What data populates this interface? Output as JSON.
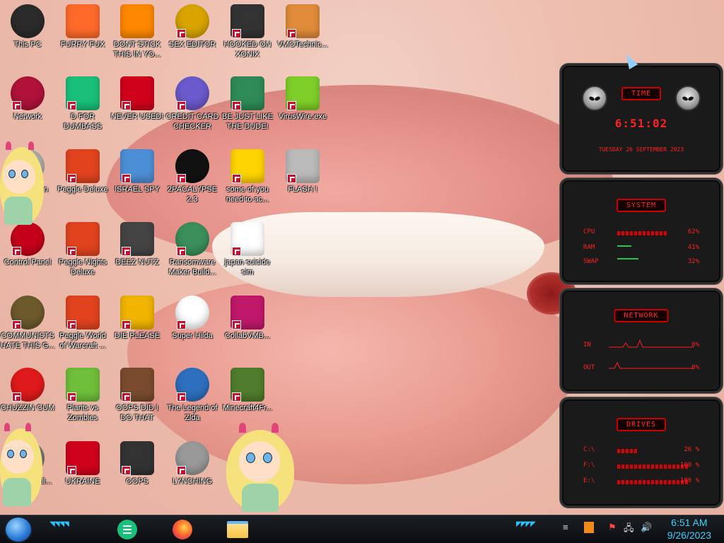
{
  "desktop": {
    "icons": [
      {
        "label": "This PC",
        "icon": "computer-icon",
        "color": "#2b2b2b"
      },
      {
        "label": "FURRY FUX",
        "icon": "firefox-icon",
        "color": "#ff6a2b"
      },
      {
        "label": "DONT STICK THIS IN YO...",
        "icon": "vlc-cone-icon",
        "color": "#ff8800"
      },
      {
        "label": "SEX EDITOR",
        "icon": "hxd-editor-icon",
        "color": "#d9a400"
      },
      {
        "label": "HOOKED ON XONIX",
        "icon": "xonix-game-icon",
        "color": "#333333"
      },
      {
        "label": "VMOTechnic...",
        "icon": "doctor-avatar-icon",
        "color": "#e08c3a"
      },
      {
        "label": "Network",
        "icon": "network-globe-icon",
        "color": "#b0123a"
      },
      {
        "label": "D FOR DUMBASS",
        "icon": "google-docs-icon",
        "color": "#18c07a"
      },
      {
        "label": "NEVER USED!",
        "icon": "dev-cpp-icon",
        "color": "#d0021b"
      },
      {
        "label": "CREDIT CARD CHECKER",
        "icon": "credit-card-icon",
        "color": "#6a5acd"
      },
      {
        "label": "BE JUST LIKE THE DUDE!",
        "icon": "elf-game-icon",
        "color": "#2e8b57"
      },
      {
        "label": "VirusWire.exe",
        "icon": "lime-disc-icon",
        "color": "#7fcf2a"
      },
      {
        "label": "Recycle Bin",
        "icon": "recycle-bin-icon",
        "color": "#aaaaaa"
      },
      {
        "label": "Peggle Deluxe",
        "icon": "peggle-icon",
        "color": "#e2431f"
      },
      {
        "label": "ISRAEL SPY",
        "icon": "network-computer-icon",
        "color": "#4d8fd6"
      },
      {
        "label": "2PACALYPSE 2.3",
        "icon": "terminal-icon",
        "color": "#111111"
      },
      {
        "label": "some of you need to ac...",
        "icon": "dog-cartoon-icon",
        "color": "#ffd400"
      },
      {
        "label": "FLASH !",
        "icon": "flash-cards-icon",
        "color": "#bbbbbb"
      },
      {
        "label": "Control Panel",
        "icon": "control-panel-icon",
        "color": "#c4001a"
      },
      {
        "label": "Peggle Nights Deluxe",
        "icon": "peggle-nights-icon",
        "color": "#e2431f"
      },
      {
        "label": "DEEZ NUTZ",
        "icon": "window-stack-icon",
        "color": "#444444"
      },
      {
        "label": "Ransomware Maker Build...",
        "icon": "app-window-icon",
        "color": "#3a8f5a"
      },
      {
        "label": "japan suicide sim",
        "icon": "game-tile-icon",
        "color": "#ffffff"
      },
      {
        "label": "",
        "icon": "none",
        "color": ""
      },
      {
        "label": "COMMUNISTS HATE THIS G...",
        "icon": "money-bag-icon",
        "color": "#6b5a2b"
      },
      {
        "label": "Peggle World of Warcraft ...",
        "icon": "peggle-warcraft-icon",
        "color": "#e2431f"
      },
      {
        "label": "DIE PLEASE",
        "icon": "de-letters-icon",
        "color": "#f0b400"
      },
      {
        "label": "Super Hilda",
        "icon": "pixel-dog-icon",
        "color": "#ffffff"
      },
      {
        "label": "CollabVMB...",
        "icon": "monitor-icon",
        "color": "#c0186b"
      },
      {
        "label": "",
        "icon": "none",
        "color": ""
      },
      {
        "label": "CHUZZIN CUM",
        "icon": "chuzzle-icon",
        "color": "#e01a1a"
      },
      {
        "label": "Plants vs Zombies",
        "icon": "plant-icon",
        "color": "#6fbf3a"
      },
      {
        "label": "OOPS DID I DO THAT",
        "icon": "portrait-icon",
        "color": "#7a4b2e"
      },
      {
        "label": "The Legend of Zlda",
        "icon": "pixel-hero-icon",
        "color": "#2f6fbf"
      },
      {
        "label": "Minecraft4Fr...",
        "icon": "grass-block-icon",
        "color": "#4f7d2b"
      },
      {
        "label": "",
        "icon": "none",
        "color": ""
      },
      {
        "label": "...oad ...k All...",
        "icon": "download-icon",
        "color": "#777777"
      },
      {
        "label": "UKRAINE",
        "icon": "radiation-icon",
        "color": "#d0021b"
      },
      {
        "label": "OOPS",
        "icon": "app-box-icon",
        "color": "#333333"
      },
      {
        "label": "LYNCHING",
        "icon": "noose-icon",
        "color": "#999999"
      }
    ]
  },
  "widgets": {
    "time": {
      "title": "TIME",
      "clock": "6:51:02",
      "date": "TUESDAY 26 SEPTEMBER 2023"
    },
    "system": {
      "title": "SYSTEM",
      "rows": [
        {
          "key": "CPU",
          "value": "62%",
          "percent": 62
        },
        {
          "key": "RAM",
          "value": "41%",
          "percent": 41
        },
        {
          "key": "SWAP",
          "value": "32%",
          "percent": 32
        }
      ]
    },
    "network": {
      "title": "NETWORK",
      "rows": [
        {
          "key": "IN",
          "value": "0%"
        },
        {
          "key": "OUT",
          "value": "0%"
        }
      ]
    },
    "drives": {
      "title": "DRIVES",
      "rows": [
        {
          "key": "C:\\",
          "value": "26 %",
          "percent": 26
        },
        {
          "key": "F:\\",
          "value": "100 %",
          "percent": 100
        },
        {
          "key": "E:\\",
          "value": "100 %",
          "percent": 100
        }
      ]
    },
    "accent": "#ff2020"
  },
  "taskbar": {
    "pinned": [
      {
        "name": "google-docs",
        "icon": "google-docs-icon",
        "color": "#18c07a"
      },
      {
        "name": "firefox",
        "icon": "firefox-icon",
        "color": "#ff6a2b"
      },
      {
        "name": "file-explorer",
        "icon": "folder-icon",
        "color": "#f5c542"
      }
    ],
    "tray_icons": [
      "menu-lines-icon",
      "flash-tray-icon",
      "flag-icon",
      "network-tray-icon",
      "volume-icon"
    ],
    "clock": {
      "time": "6:51 AM",
      "date": "9/26/2023"
    },
    "accent": "#3fd0ff"
  }
}
